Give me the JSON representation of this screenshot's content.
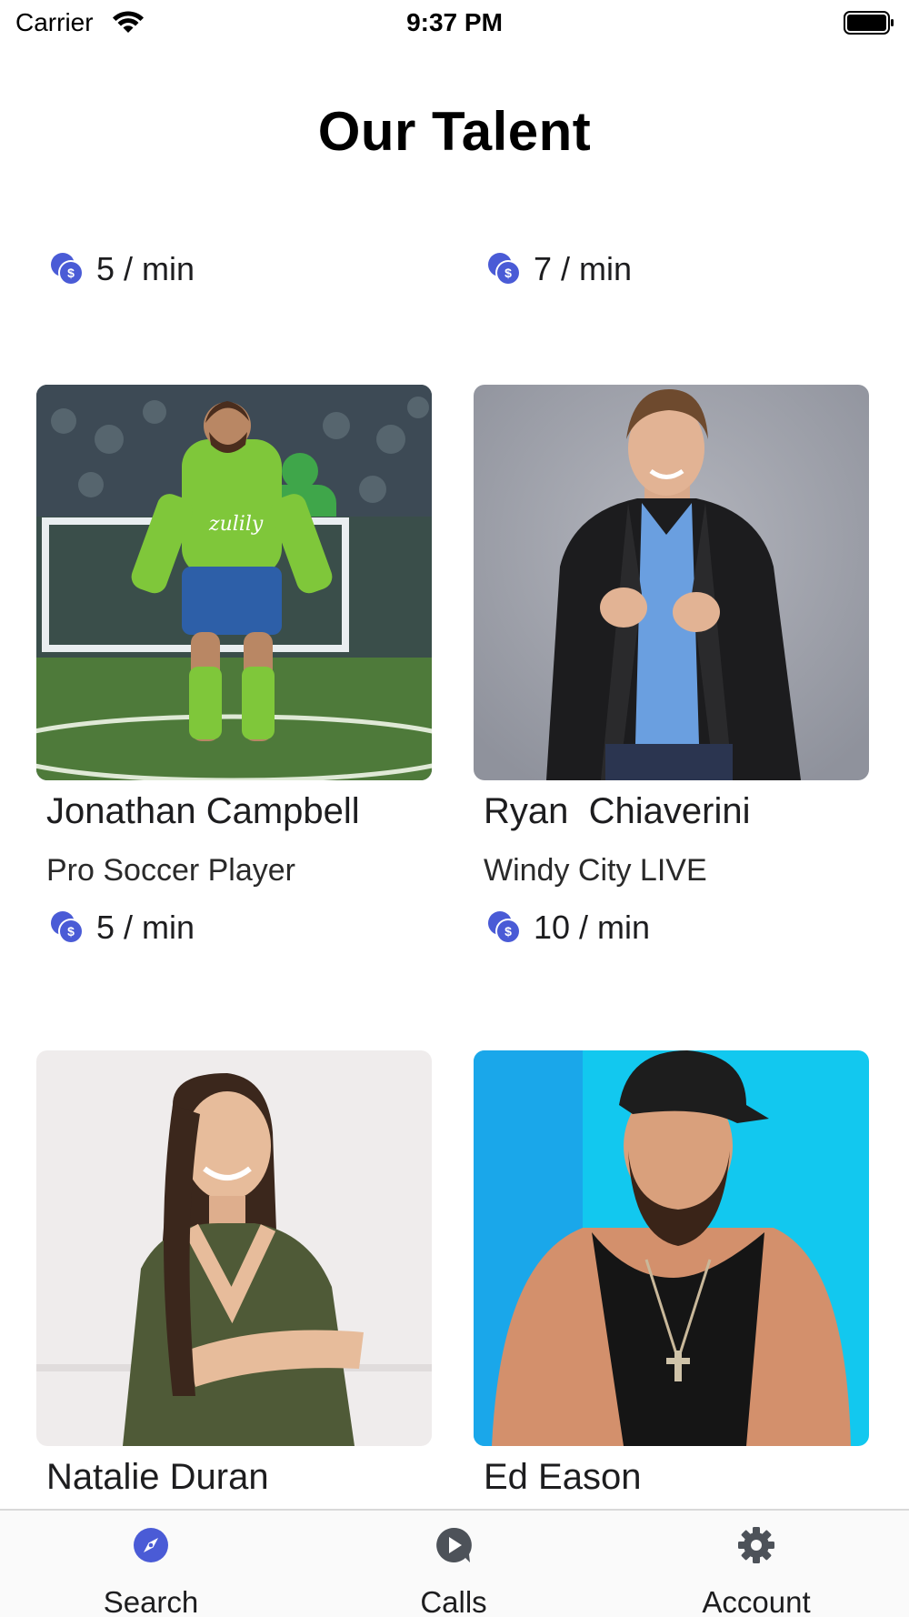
{
  "status_bar": {
    "carrier": "Carrier",
    "time": "9:37 PM"
  },
  "page": {
    "title": "Our Talent"
  },
  "colors": {
    "accent": "#4a5bd6",
    "tab_icon_inactive": "#4d5259",
    "tab_bar_bg": "#fafafa"
  },
  "talent": [
    {
      "name": "",
      "subtitle": "",
      "rate": "5 / min",
      "photo": "partially-scrolled-off"
    },
    {
      "name": "",
      "subtitle": "",
      "rate": "7 / min",
      "photo": "partially-scrolled-off"
    },
    {
      "name": "Jonathan Campbell",
      "subtitle": "Pro Soccer Player",
      "rate": "5 / min",
      "photo": "soccer-player-photo"
    },
    {
      "name": "Ryan  Chiaverini",
      "subtitle": "Windy City LIVE",
      "rate": "10 / min",
      "photo": "leather-jacket-portrait"
    },
    {
      "name": "Natalie Duran",
      "subtitle": "",
      "rate": "",
      "photo": "woman-portrait"
    },
    {
      "name": "Ed Eason",
      "subtitle": "",
      "rate": "",
      "photo": "bearded-man-portrait"
    }
  ],
  "tabs": [
    {
      "label": "Search",
      "icon": "compass-icon",
      "selected": true
    },
    {
      "label": "Calls",
      "icon": "play-bubble-icon",
      "selected": false
    },
    {
      "label": "Account",
      "icon": "gear-icon",
      "selected": false
    }
  ]
}
